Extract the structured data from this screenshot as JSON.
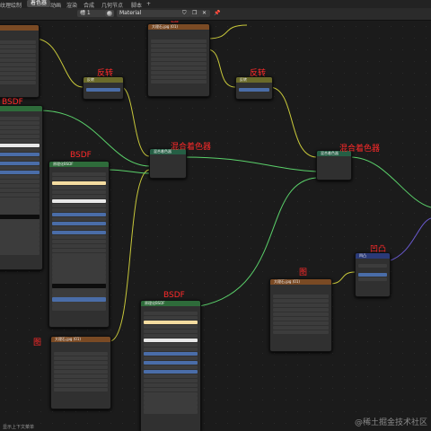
{
  "topbar": {
    "tabs": [
      "纹理绘制",
      "着色器",
      "动画",
      "渲染",
      "合成",
      "几何节点",
      "脚本",
      "+"
    ],
    "active_tab": "着色器"
  },
  "header": {
    "slot": "槽 1",
    "material_name": "Material"
  },
  "annotations": {
    "bsdf_top_left": "BSDF",
    "bsdf_middle": "BSDF",
    "bsdf_bottom": "BSDF",
    "image_top": "图",
    "image_left_bottom": "图",
    "image_right": "图",
    "invert_left": "反转",
    "invert_right": "反转",
    "mix_left": "混合着色器",
    "mix_right": "混合着色器",
    "bump": "凹凸"
  },
  "nodes": {
    "image_top": {
      "title": "大理石.jpg (01)"
    },
    "image_bottom_left": {
      "title": "大理石.jpg (01)"
    },
    "image_right": {
      "title": "大理石.jpg (01)"
    },
    "bsdf_middle": {
      "title": "原理化BSDF"
    },
    "bsdf_bottom": {
      "title": "原理化BSDF"
    },
    "invert_left": {
      "title": "反转"
    },
    "invert_right": {
      "title": "反转"
    },
    "mix_left": {
      "title": "混合着色器"
    },
    "mix_right": {
      "title": "混合着色器"
    },
    "bump": {
      "title": "凹凸"
    }
  },
  "footer": {
    "text": "显示上下文菜单"
  },
  "watermark": "@稀土掘金技术社区",
  "colors": {
    "yellow_wire": "#c8c83a",
    "green_wire": "#5ad06a",
    "purple_wire": "#6a5ad0",
    "annotation_red": "#ff2a2a"
  }
}
